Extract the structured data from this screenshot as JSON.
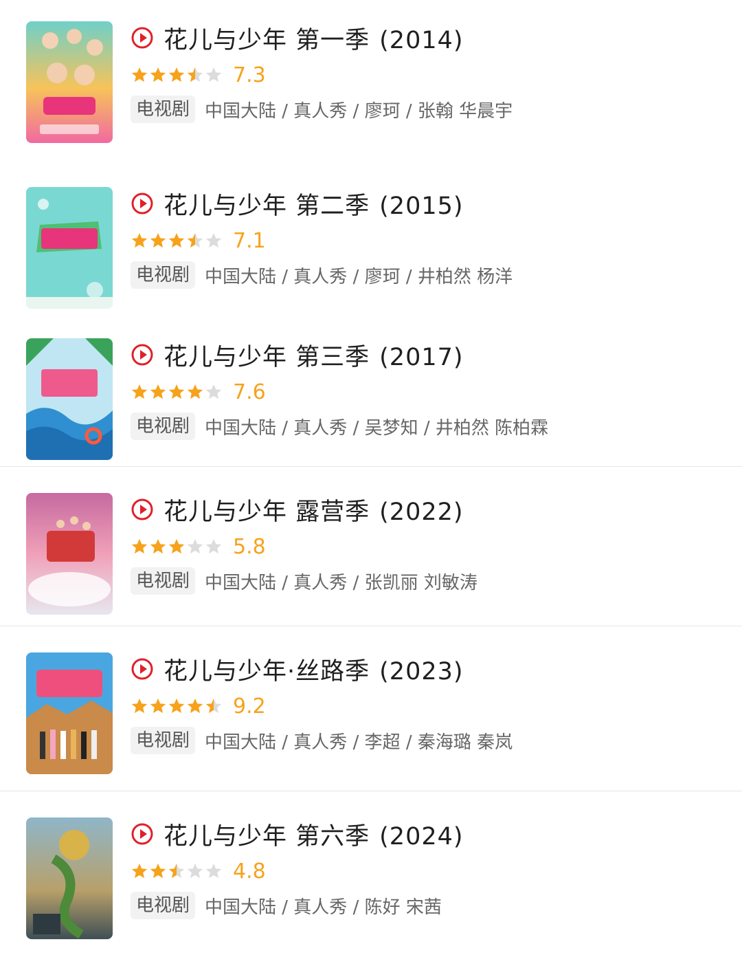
{
  "colors": {
    "accent_red": "#e0202a",
    "star": "#f7a21b",
    "star_empty": "#dcdcdc",
    "tag_bg": "#f2f2f2"
  },
  "icons": {
    "play": "play-circle-icon",
    "star": "star-icon"
  },
  "items": [
    {
      "title": "花儿与少年 第一季",
      "year": "(2014)",
      "rating": "7.3",
      "stars": 3.5,
      "tag": "电视剧",
      "info": "中国大陆 / 真人秀 / 廖珂 / 张翰 华晨宇"
    },
    {
      "title": "花儿与少年 第二季",
      "year": "(2015)",
      "rating": "7.1",
      "stars": 3.5,
      "tag": "电视剧",
      "info": "中国大陆 / 真人秀 / 廖珂 / 井柏然 杨洋"
    },
    {
      "title": "花儿与少年 第三季",
      "year": "(2017)",
      "rating": "7.6",
      "stars": 4,
      "tag": "电视剧",
      "info": "中国大陆 / 真人秀 / 吴梦知 / 井柏然 陈柏霖"
    },
    {
      "title": "花儿与少年 露营季",
      "year": "(2022)",
      "rating": "5.8",
      "stars": 3,
      "tag": "电视剧",
      "info": "中国大陆 / 真人秀 / 张凯丽 刘敏涛"
    },
    {
      "title": "花儿与少年·丝路季",
      "year": "(2023)",
      "rating": "9.2",
      "stars": 4.5,
      "tag": "电视剧",
      "info": "中国大陆 / 真人秀 / 李超 / 秦海璐 秦岚"
    },
    {
      "title": "花儿与少年 第六季",
      "year": "(2024)",
      "rating": "4.8",
      "stars": 2.5,
      "tag": "电视剧",
      "info": "中国大陆 / 真人秀 / 陈好 宋茜"
    }
  ]
}
